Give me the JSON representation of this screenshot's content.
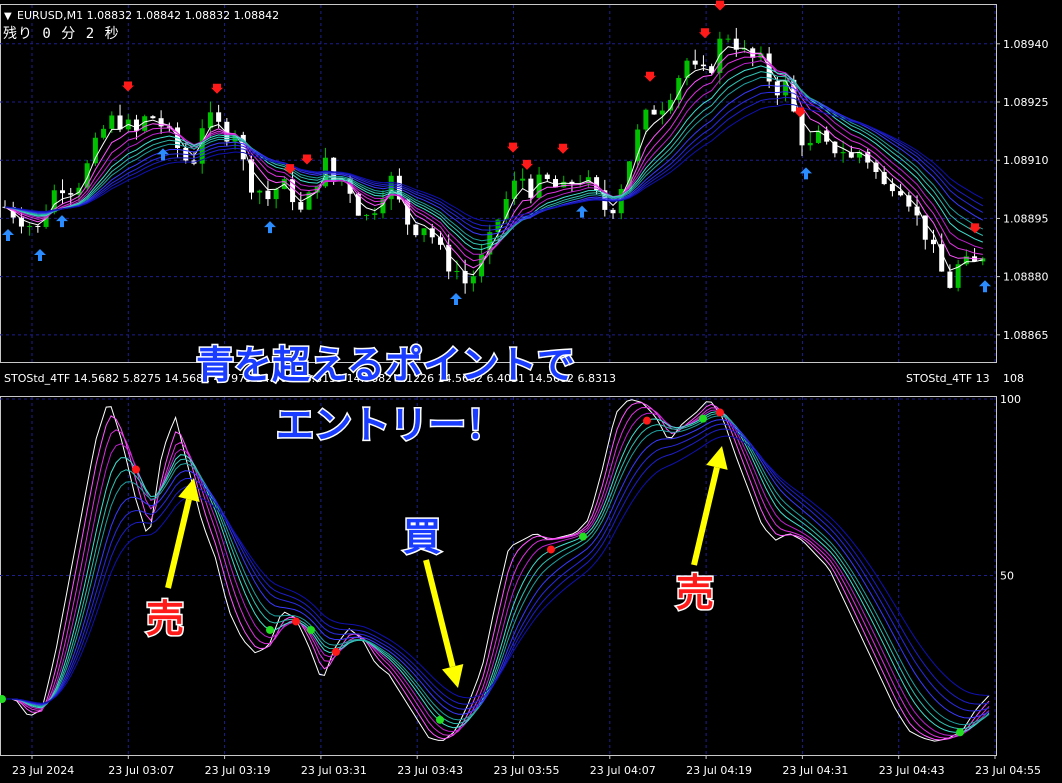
{
  "header": {
    "symbol_line": "EURUSD,M1  1.08832 1.08842 1.08832 1.08842",
    "countdown": "残り 0 分 2 秒"
  },
  "indicator": {
    "header_text": "STOStd_4TF 14.5682 5.8275 14.5682 4.7975 14.5682 6.3139 14.5682 6.1226 14.5682 6.4031 14.5682 6.8313",
    "header_right": "STOStd_4TF 13",
    "right_value": "108"
  },
  "annotations": {
    "headline_1": "青を超えるポイントで",
    "headline_2": "エントリー！",
    "sell_1": "売",
    "sell_2": "売",
    "buy": "買"
  },
  "colors": {
    "background": "#000000",
    "up_candle": "#00c000",
    "down_candle": "#ffffff",
    "grid": "#1e1e8c",
    "sell_marker": "#ff1a1a",
    "buy_marker": "#2b8cff",
    "headline_fill": "#1a3cff",
    "arrow_yellow": "#ffff00"
  },
  "chart_data": [
    {
      "type": "candlestick",
      "symbol": "EURUSD",
      "timeframe": "M1",
      "y_ticks": [
        1.0894,
        1.08925,
        1.0891,
        1.08895,
        1.0888,
        1.08865
      ],
      "y_tick_labels": [
        "1.08940",
        "1.08925",
        "1.08910",
        "1.08895",
        "1.08880",
        "1.08865"
      ],
      "ylim": [
        1.08858,
        1.0895
      ],
      "grid": true,
      "x_tick_labels": [
        "23 Jul 2024",
        "23 Jul 03:07",
        "23 Jul 03:19",
        "23 Jul 03:31",
        "23 Jul 03:43",
        "23 Jul 03:55",
        "23 Jul 04:07",
        "23 Jul 04:19",
        "23 Jul 04:31",
        "23 Jul 04:43",
        "23 Jul 04:55"
      ],
      "close_path": [
        1.08898,
        1.08896,
        1.08894,
        1.08892,
        1.089,
        1.08904,
        1.08903,
        1.08905,
        1.08912,
        1.08918,
        1.08921,
        1.08919,
        1.08917,
        1.08922,
        1.0892,
        1.08916,
        1.08912,
        1.08908,
        1.0892,
        1.0892,
        1.08917,
        1.08918,
        1.08905,
        1.08903,
        1.089,
        1.08904,
        1.08902,
        1.08896,
        1.08902,
        1.0891,
        1.08904,
        1.08906,
        1.08898,
        1.08895,
        1.089,
        1.08906,
        1.08898,
        1.08892,
        1.08894,
        1.0889,
        1.08884,
        1.08882,
        1.08878,
        1.08882,
        1.08888,
        1.08896,
        1.08902,
        1.08906,
        1.08902,
        1.08905,
        1.08903,
        1.08902,
        1.08906,
        1.08904,
        1.089,
        1.08896,
        1.08903,
        1.08912,
        1.0892,
        1.08923,
        1.08925,
        1.0893,
        1.08936,
        1.08932,
        1.08932,
        1.0894,
        1.08943,
        1.08938,
        1.08936,
        1.08935,
        1.08928,
        1.0893,
        1.0892,
        1.08912,
        1.08916,
        1.08912,
        1.08914,
        1.0891,
        1.08913,
        1.08908,
        1.08903,
        1.08905,
        1.08902,
        1.08895,
        1.0889,
        1.08882,
        1.08878,
        1.08884,
        1.08882,
        1.08886
      ],
      "sell_signal_count": 12,
      "buy_signal_count": 9
    },
    {
      "type": "line",
      "title": "STOStd_4TF",
      "ylim": [
        0,
        100
      ],
      "y_tick_labels": [
        "100",
        "50"
      ],
      "stochastic_path": [
        15,
        15,
        10,
        12,
        28,
        48,
        68,
        88,
        100,
        88,
        72,
        60,
        85,
        95,
        80,
        65,
        55,
        40,
        32,
        28,
        30,
        40,
        38,
        30,
        20,
        30,
        35,
        32,
        25,
        22,
        16,
        10,
        4,
        3,
        6,
        14,
        24,
        42,
        58,
        60,
        62,
        60,
        61,
        62,
        66,
        80,
        96,
        100,
        99,
        95,
        88,
        93,
        96,
        100,
        95,
        84,
        74,
        64,
        60,
        62,
        60,
        56,
        52,
        44,
        36,
        28,
        20,
        12,
        6,
        4,
        3,
        4,
        6,
        12,
        16
      ],
      "series": []
    }
  ]
}
